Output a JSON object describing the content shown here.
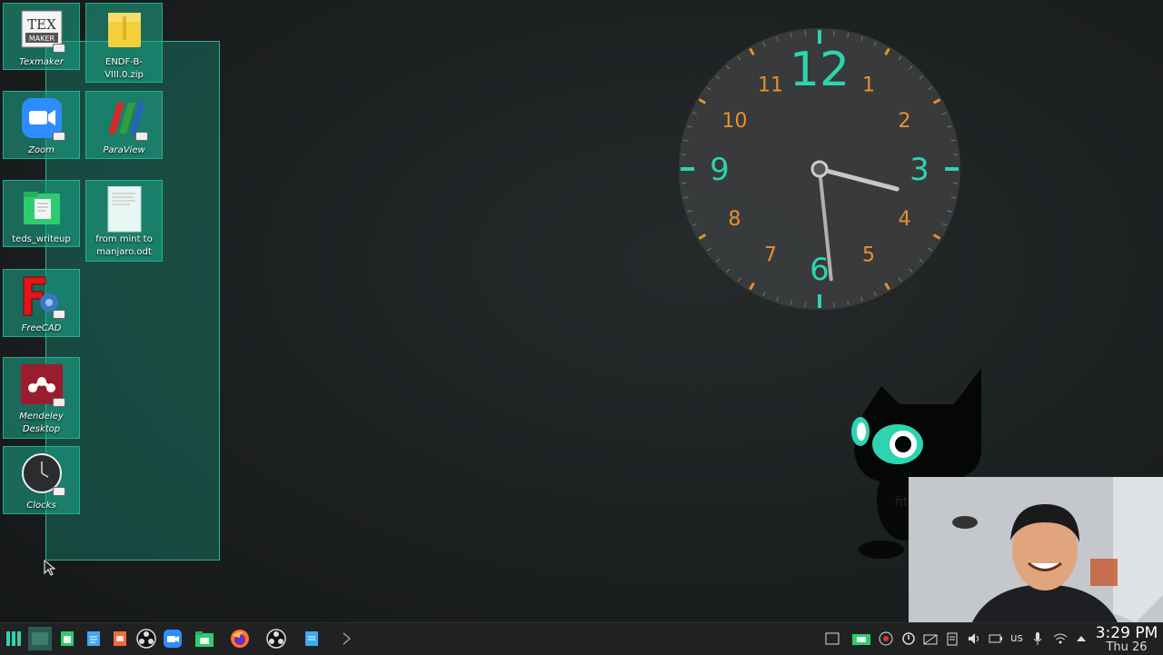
{
  "desktop": {
    "icons": [
      {
        "label": "Texmaker",
        "icon": "texmaker-icon",
        "italic": true
      },
      {
        "label": "ENDF-B-VIII.0.zip",
        "icon": "zip-archive-icon",
        "italic": false
      },
      {
        "label": "Zoom",
        "icon": "zoom-icon",
        "italic": true
      },
      {
        "label": "ParaView",
        "icon": "paraview-icon",
        "italic": true
      },
      {
        "label": "teds_writeup",
        "icon": "folder-icon",
        "italic": false
      },
      {
        "label": "from mint to manjaro.odt",
        "icon": "document-icon",
        "italic": false
      },
      {
        "label": "FreeCAD",
        "icon": "freecad-icon",
        "italic": true
      },
      {
        "label": "Mendeley Desktop",
        "icon": "mendeley-icon",
        "italic": true
      },
      {
        "label": "Clocks",
        "icon": "clocks-icon",
        "italic": true
      }
    ]
  },
  "clock_widget": {
    "numbers": [
      "12",
      "1",
      "2",
      "3",
      "4",
      "5",
      "6",
      "7",
      "8",
      "9",
      "10",
      "11"
    ],
    "hour": 3,
    "minute": 29,
    "accent_color": "#2ed3b0",
    "number_color": "#e8902c"
  },
  "taskbar": {
    "apps": [
      "menu-icon",
      "desktop-pager-icon",
      "spreadsheet-icon",
      "files-icon",
      "presentation-icon",
      "obs-icon",
      "zoom-icon",
      "file-manager-icon",
      "firefox-icon",
      "obs-icon",
      "document-icon",
      "terminal-icon"
    ],
    "tray": {
      "keyboard_layout": "us",
      "time": "3:29 PM",
      "date": "Thu 26"
    }
  },
  "colors": {
    "selection": "#16a085",
    "taskbar_bg": "#1f2122",
    "accent": "#2ed3b0"
  }
}
